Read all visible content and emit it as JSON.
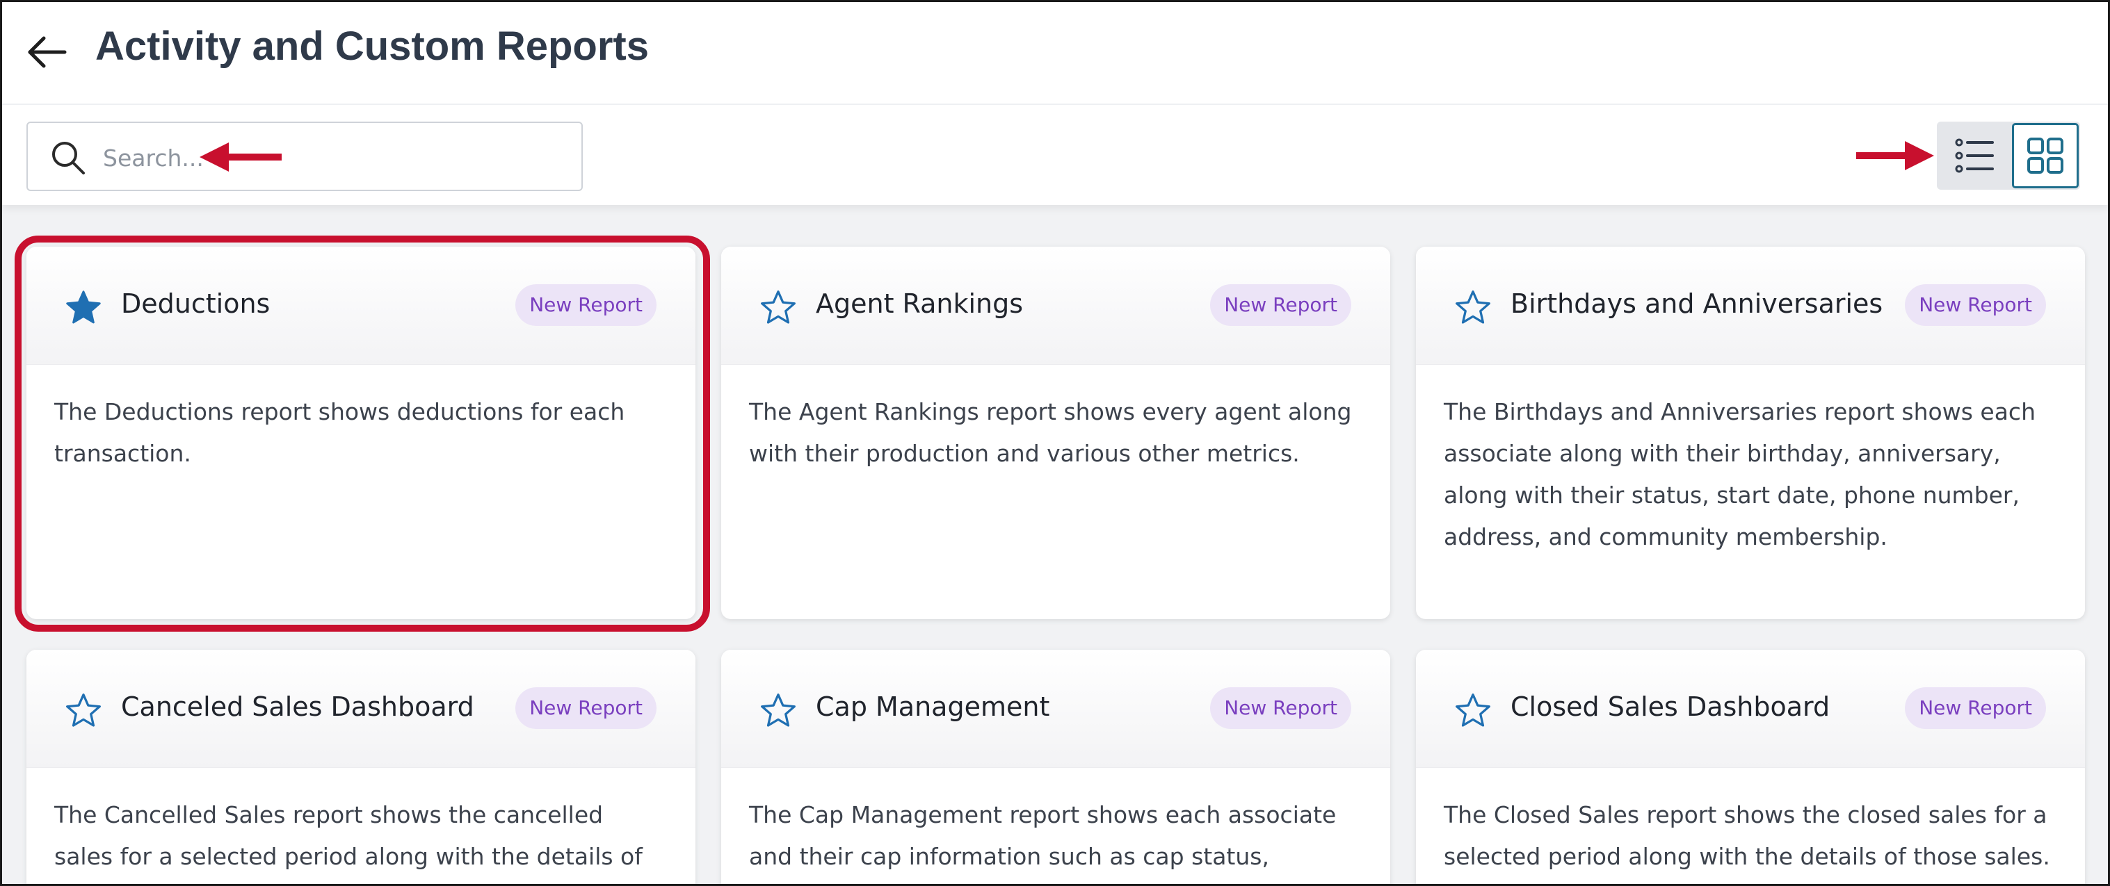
{
  "header": {
    "title": "Activity and Custom Reports"
  },
  "search": {
    "placeholder": "Search..."
  },
  "view_toggle": {
    "active": "grid",
    "accent_color": "#1f6e8c"
  },
  "annotation_color": "#c8102e",
  "cards": [
    {
      "title": "Deductions",
      "badge": "New Report",
      "favorited": true,
      "description": "The Deductions report shows deductions for each transaction."
    },
    {
      "title": "Agent Rankings",
      "badge": "New Report",
      "favorited": false,
      "description": "The Agent Rankings report shows every agent along with their production and various other metrics."
    },
    {
      "title": "Birthdays and Anniversaries",
      "badge": "New Report",
      "favorited": false,
      "description": "The Birthdays and Anniversaries report shows each associate along with their birthday, anniversary, along with their status, start date, phone number, address, and community membership."
    },
    {
      "title": "Canceled Sales Dashboard",
      "badge": "New Report",
      "favorited": false,
      "description": "The Cancelled Sales report shows the cancelled sales for a selected period along with the details of those"
    },
    {
      "title": "Cap Management",
      "badge": "New Report",
      "favorited": false,
      "description": "The Cap Management report shows each associate and their cap information such as cap status, whether"
    },
    {
      "title": "Closed Sales Dashboard",
      "badge": "New Report",
      "favorited": false,
      "description": "The Closed Sales report shows the closed sales for a selected period along with the details of those sales."
    }
  ]
}
